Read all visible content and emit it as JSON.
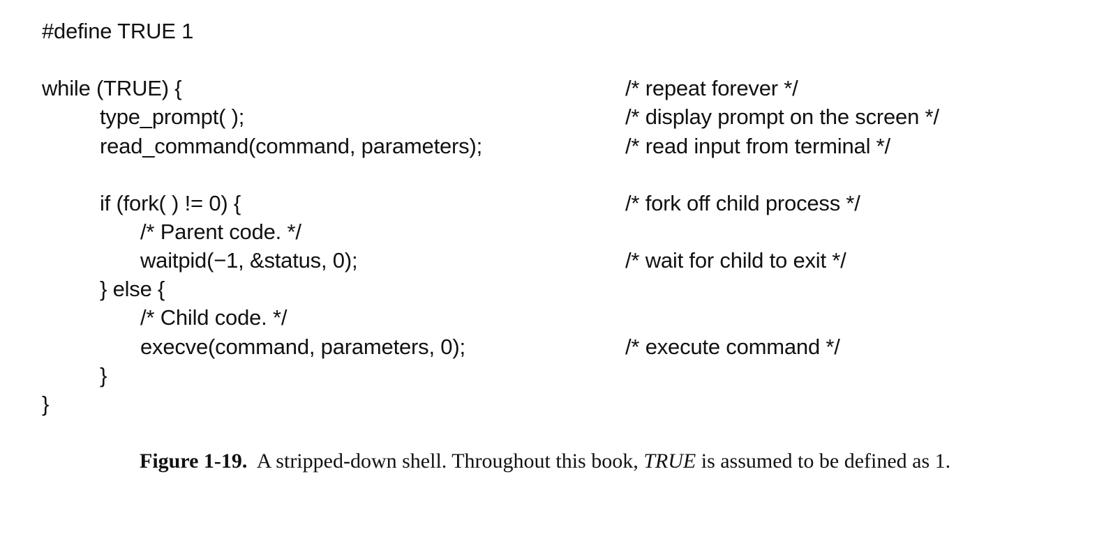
{
  "code": {
    "define": "#define TRUE 1",
    "while_open": "while (TRUE) {",
    "type_prompt": "type_prompt( );",
    "read_command": "read_command(command, parameters);",
    "if_fork": "if (fork( ) != 0) {",
    "parent_comment": "/* Parent code. */",
    "waitpid": "waitpid(−1, &status, 0);",
    "else_open": "} else {",
    "child_comment": "/* Child code. */",
    "execve": "execve(command, parameters, 0);",
    "inner_close": "}",
    "outer_close": "}"
  },
  "comments": {
    "repeat": "/* repeat forever */",
    "display": "/* display prompt on the screen */",
    "read": "/* read input from terminal */",
    "fork": "/* fork off child process */",
    "wait": "/* wait for child to exit */",
    "execute": "/* execute command */"
  },
  "caption": {
    "label": "Figure 1-19.",
    "text_before": "A stripped-down shell. Throughout this book, ",
    "emphasis": "TRUE",
    "text_after": " is assumed to be defined as 1."
  }
}
